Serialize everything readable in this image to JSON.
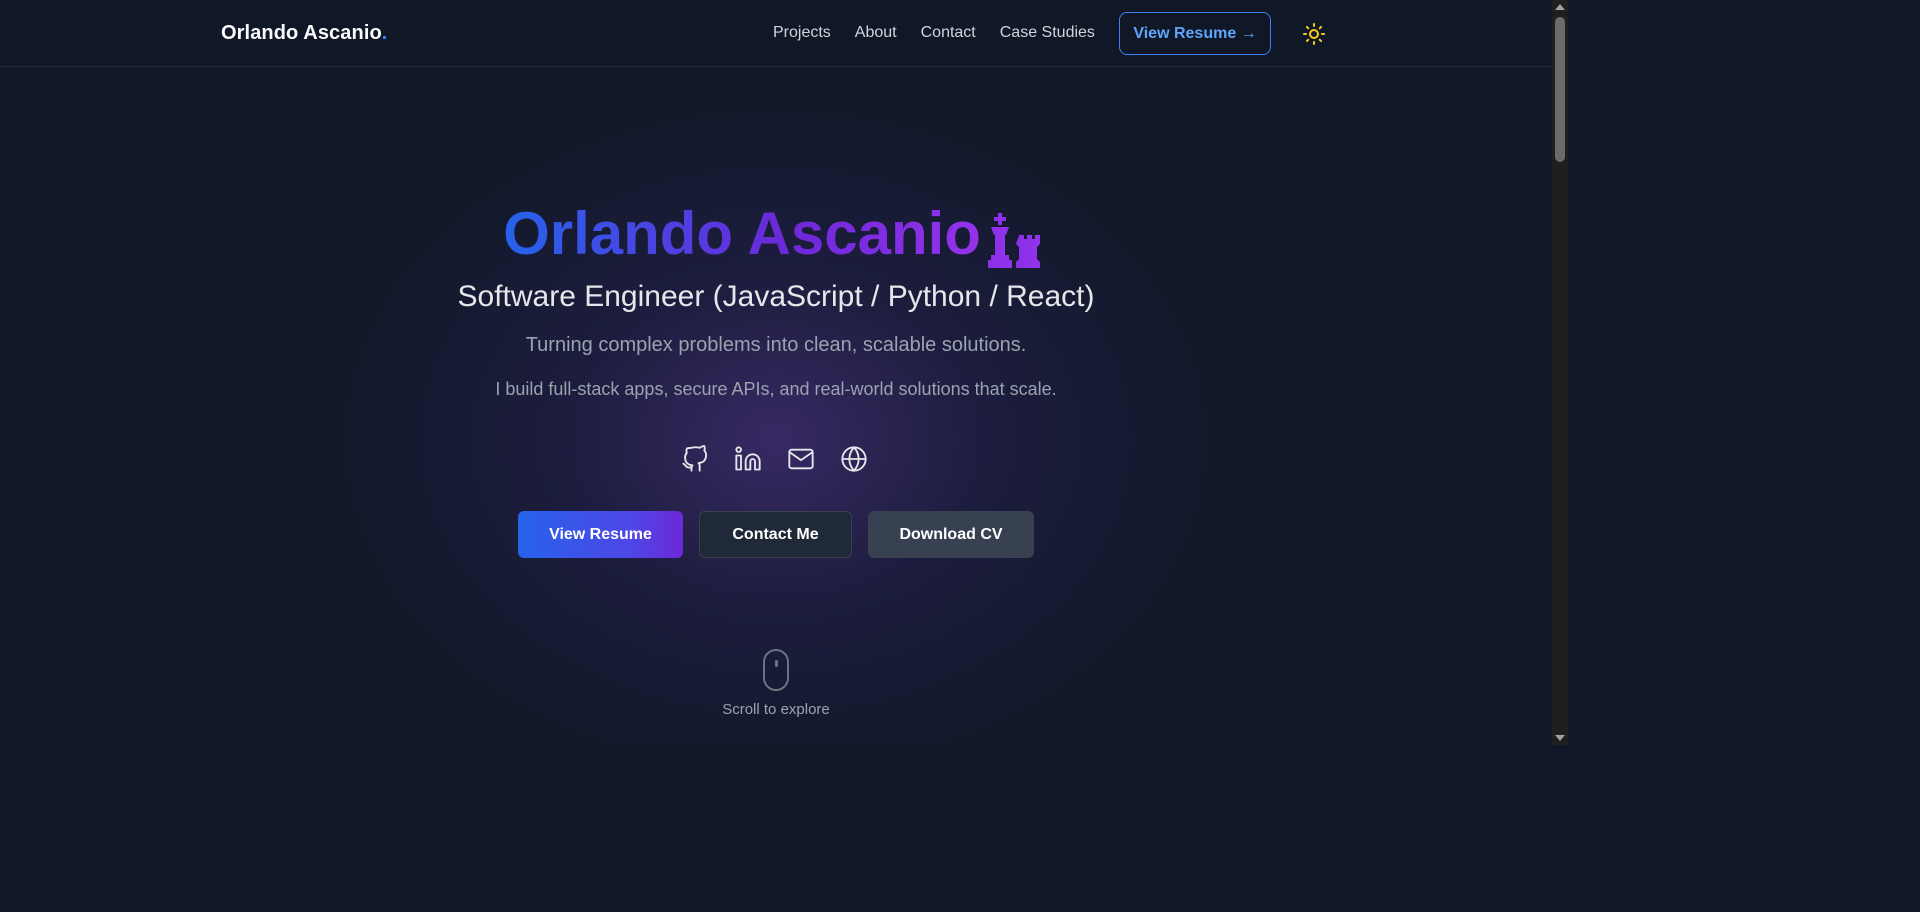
{
  "nav": {
    "brand": "Orlando Ascanio",
    "brand_dot": ".",
    "links": [
      {
        "label": "Projects"
      },
      {
        "label": "About"
      },
      {
        "label": "Contact"
      },
      {
        "label": "Case Studies"
      }
    ],
    "resume_button": "View Resume →",
    "theme_icon": "sun-icon"
  },
  "hero": {
    "name": "Orlando Ascanio",
    "title_icons": [
      "chess-king-icon",
      "chess-rook-icon"
    ],
    "subtitle": "Software Engineer (JavaScript / Python / React)",
    "tagline": "Turning complex problems into clean, scalable solutions.",
    "description": "I build full-stack apps, secure APIs, and real-world solutions that scale.",
    "socials": [
      {
        "icon": "github-icon"
      },
      {
        "icon": "linkedin-icon"
      },
      {
        "icon": "mail-icon"
      },
      {
        "icon": "globe-icon"
      }
    ],
    "buttons": {
      "primary": "View Resume",
      "contact": "Contact Me",
      "download": "Download CV"
    },
    "scroll_label": "Scroll to explore"
  },
  "colors": {
    "background": "#111827",
    "accent_blue": "#2563eb",
    "accent_purple": "#9333ea",
    "sun": "#facc15"
  }
}
